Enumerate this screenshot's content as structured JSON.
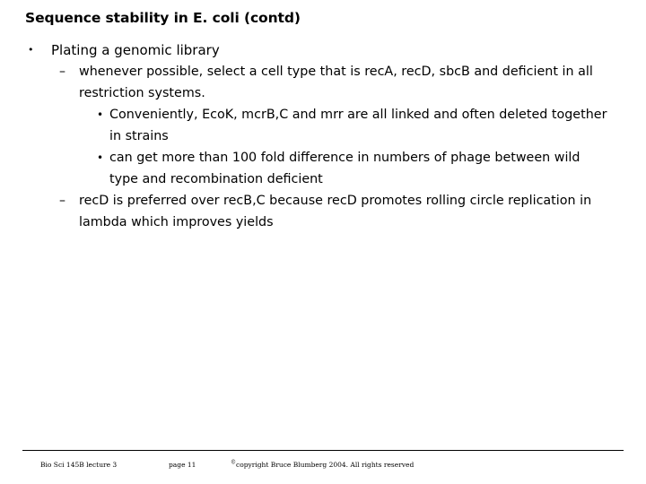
{
  "slide": {
    "title": "Sequence stability in E. coli (contd)",
    "outline": [
      {
        "level": 1,
        "marker": "•",
        "marker_name": "bullet-dot",
        "text": "Plating a genomic library"
      },
      {
        "level": 2,
        "marker": "–",
        "marker_name": "bullet-dash",
        "text": "whenever possible, select a cell type that is recA, recD, sbcB and deficient in all restriction systems."
      },
      {
        "level": 3,
        "marker": "•",
        "marker_name": "bullet-dot",
        "text": "Conveniently, EcoK, mcrB,C and mrr are all linked and often deleted together in strains"
      },
      {
        "level": 3,
        "marker": "•",
        "marker_name": "bullet-dot",
        "text": "can get more than 100 fold difference in numbers of phage between wild type and recombination deficient"
      },
      {
        "level": 2,
        "marker": "–",
        "marker_name": "bullet-dash",
        "text": "recD is preferred over recB,C because recD promotes rolling circle replication in lambda which improves yields"
      }
    ]
  },
  "footer": {
    "lecture": "Bio Sci 145B lecture 3",
    "page": "page 11",
    "copyright_mark": "©",
    "copyright": "copyright Bruce Blumberg 2004. All rights reserved"
  },
  "colors": {
    "background": "#ffffff",
    "text": "#000000",
    "rule": "#000000"
  }
}
